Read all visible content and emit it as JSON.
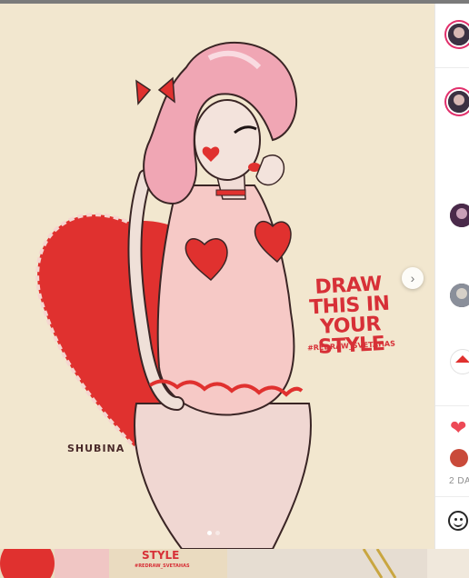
{
  "post": {
    "art_headline": "DRAW THIS IN YOUR STYLE",
    "art_hashtag": "#REDRAW_SVETAHAS",
    "signature": "SHUBINA",
    "next_icon": "chevron-right-icon",
    "carousel": {
      "total": 2,
      "active": 1
    }
  },
  "sidebar": {
    "date": "2 DA",
    "like_icon": "heart-icon",
    "emoji_icon": "smiley-icon"
  },
  "bottom_strip": {
    "thumb_text": "STYLE",
    "thumb_sub": "#REDRAW_SVETAHAS"
  },
  "colors": {
    "background": "#f2e7cf",
    "accent_red": "#d73037",
    "pink_hair": "#f0a6b4",
    "like_red": "#ed4956"
  }
}
